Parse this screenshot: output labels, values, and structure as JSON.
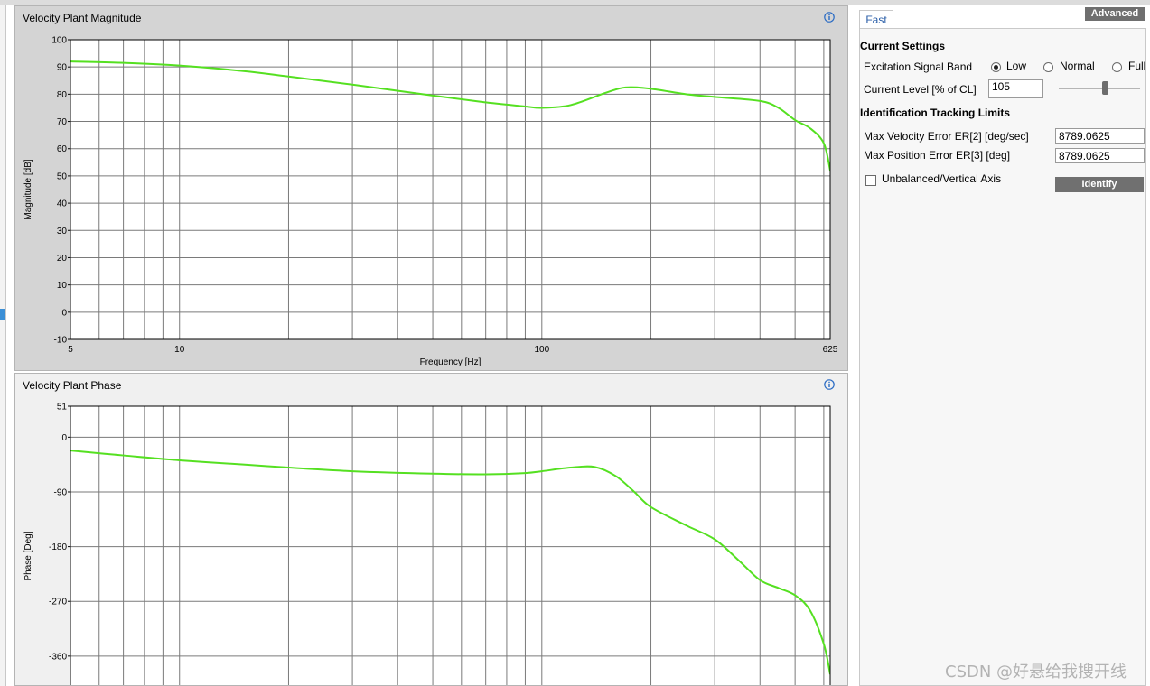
{
  "magnitude_panel": {
    "title": "Velocity Plant Magnitude"
  },
  "phase_panel": {
    "title": "Velocity Plant Phase"
  },
  "icons": {
    "info": "info-icon"
  },
  "colors": {
    "curve": "#55e021",
    "grid": "#7a7a7a",
    "plot_bg": "#ffffff",
    "advanced_btn": "#6f6f6f"
  },
  "chart_data": [
    {
      "type": "line",
      "title": "Velocity Plant Magnitude",
      "xlabel": "Frequency [Hz]",
      "ylabel": "Magnitude [dB]",
      "x_scale": "log",
      "xlim": [
        5,
        625
      ],
      "ylim": [
        -10,
        100
      ],
      "x_ticks": [
        5,
        10,
        100,
        625
      ],
      "y_ticks": [
        -10,
        0,
        10,
        20,
        30,
        40,
        50,
        60,
        70,
        80,
        90,
        100
      ],
      "grid": true,
      "series": [
        {
          "x": [
            5,
            7,
            10,
            15,
            20,
            30,
            50,
            70,
            90,
            100,
            120,
            150,
            170,
            200,
            250,
            300,
            400,
            450,
            500,
            550,
            600,
            625
          ],
          "values": [
            92,
            91.5,
            90.5,
            88.5,
            86.5,
            83.5,
            79.5,
            77,
            75.5,
            75,
            76,
            80.5,
            82.5,
            82,
            80,
            79,
            77.5,
            75,
            70.5,
            67.5,
            62,
            52
          ]
        }
      ]
    },
    {
      "type": "line",
      "title": "Velocity Plant Phase",
      "xlabel": "",
      "ylabel": "Phase [Deg]",
      "x_scale": "log",
      "xlim": [
        5,
        625
      ],
      "ylim": [
        -430,
        51
      ],
      "y_ticks": [
        51,
        0,
        -90,
        -180,
        -270,
        -360
      ],
      "grid": true,
      "series": [
        {
          "x": [
            5,
            7,
            10,
            15,
            20,
            30,
            50,
            70,
            90,
            100,
            120,
            140,
            160,
            180,
            200,
            250,
            300,
            350,
            400,
            450,
            500,
            550,
            600,
            625
          ],
          "values": [
            -22,
            -30,
            -38,
            -45,
            -50,
            -56,
            -60,
            -61,
            -59,
            -56,
            -50,
            -49,
            -64,
            -90,
            -115,
            -145,
            -168,
            -203,
            -235,
            -248,
            -260,
            -285,
            -340,
            -390
          ]
        }
      ]
    }
  ],
  "right_panel": {
    "tab_fast": "Fast",
    "advanced_button": "Advanced",
    "current_settings_title": "Current Settings",
    "excitation_label": "Excitation Signal Band",
    "band_options": [
      "Low",
      "Normal",
      "Full"
    ],
    "band_selected": "Low",
    "current_level_label": "Current Level [% of CL]",
    "current_level_value": "105",
    "current_level_slider_fraction": 0.61,
    "tracking_title": "Identification Tracking Limits",
    "max_vel_label": "Max Velocity Error ER[2] [deg/sec]",
    "max_vel_value": "8789.0625",
    "max_pos_label": "Max Position Error ER[3] [deg]",
    "max_pos_value": "8789.0625",
    "unbalanced_label": "Unbalanced/Vertical Axis",
    "unbalanced_checked": false,
    "identify_button": "Identify"
  },
  "watermark": "CSDN @好悬给我搜开线"
}
